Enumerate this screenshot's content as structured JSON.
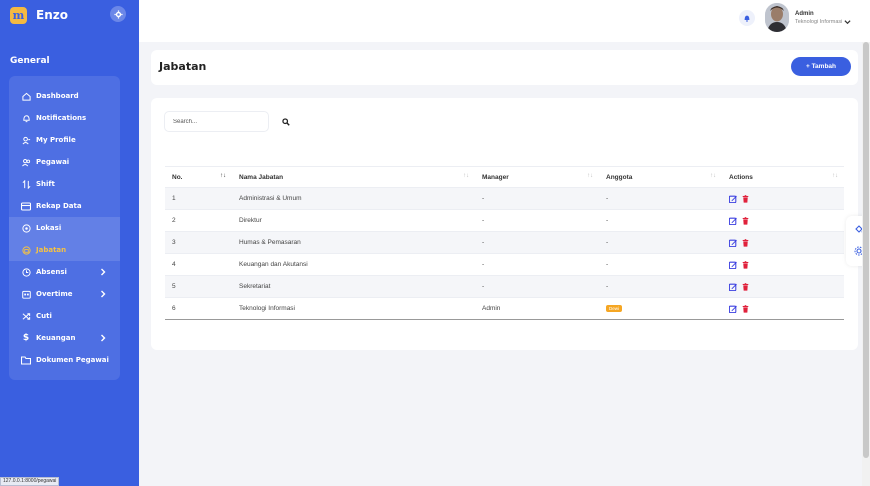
{
  "sidebar": {
    "brand": {
      "logo_text": "m",
      "name": "Enzo"
    },
    "heading": "General",
    "items": [
      {
        "label": "Dashboard",
        "icon": "home-icon"
      },
      {
        "label": "Notifications",
        "icon": "bell-icon"
      },
      {
        "label": "My Profile",
        "icon": "user-icon"
      },
      {
        "label": "Pegawai",
        "icon": "users-icon"
      },
      {
        "label": "Shift",
        "icon": "swap-icon"
      },
      {
        "label": "Rekap Data",
        "icon": "card-icon"
      },
      {
        "label": "Lokasi",
        "icon": "location-icon"
      },
      {
        "label": "Jabatan",
        "icon": "briefcase-icon",
        "active": true
      },
      {
        "label": "Absensi",
        "icon": "clock-icon",
        "has_submenu": true
      },
      {
        "label": "Overtime",
        "icon": "calendar-icon",
        "has_submenu": true
      },
      {
        "label": "Cuti",
        "icon": "shuffle-icon"
      },
      {
        "label": "Keuangan",
        "icon": "dollar-icon",
        "has_submenu": true
      },
      {
        "label": "Dokumen Pegawai",
        "icon": "folder-icon"
      }
    ]
  },
  "status_url": "127.0.0.1:8000/pegawai",
  "topbar": {
    "user_name": "Admin",
    "user_role": "Teknologi Informasi"
  },
  "page": {
    "title": "Jabatan",
    "add_button": "+ Tambah"
  },
  "search": {
    "placeholder": "Search..."
  },
  "table": {
    "columns": [
      "No.",
      "Nama Jabatan",
      "Manager",
      "Anggota",
      "Actions"
    ],
    "rows": [
      {
        "no": "1",
        "nama": "Administrasi & Umum",
        "manager": "-",
        "anggota": "-"
      },
      {
        "no": "2",
        "nama": "Direktur",
        "manager": "-",
        "anggota": "-"
      },
      {
        "no": "3",
        "nama": "Humas & Pemasaran",
        "manager": "-",
        "anggota": "-"
      },
      {
        "no": "4",
        "nama": "Keuangan dan Akutansi",
        "manager": "-",
        "anggota": "-"
      },
      {
        "no": "5",
        "nama": "Sekretariat",
        "manager": "-",
        "anggota": "-"
      },
      {
        "no": "6",
        "nama": "Teknologi Informasi",
        "manager": "Admin",
        "anggota": "Dewi"
      }
    ]
  },
  "colors": {
    "sidebar": "#3a5fe0",
    "accent": "#3a5fe0",
    "active_menu": "#f5c243",
    "edit_icon": "#3b3fe0",
    "delete_icon": "#e0213b",
    "badge": "#f5a623"
  }
}
